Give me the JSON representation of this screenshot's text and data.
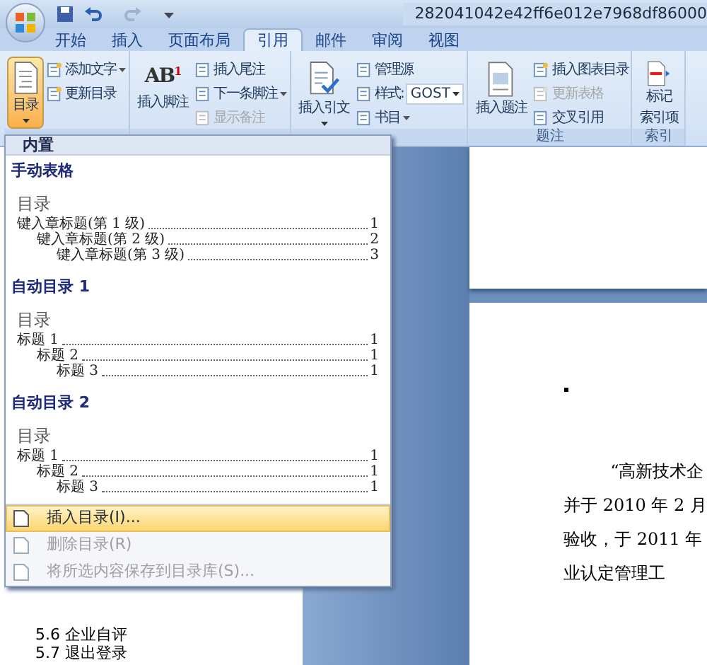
{
  "title_bar": {
    "title": "282041042e42ff6e012e7968df86000"
  },
  "tabs": [
    {
      "label": "开始",
      "selected": false
    },
    {
      "label": "插入",
      "selected": false
    },
    {
      "label": "页面布局",
      "selected": false
    },
    {
      "label": "引用",
      "selected": true
    },
    {
      "label": "邮件",
      "selected": false
    },
    {
      "label": "审阅",
      "selected": false
    },
    {
      "label": "视图",
      "selected": false
    }
  ],
  "ribbon": {
    "groups": [
      {
        "big": {
          "lines": [
            "目录"
          ],
          "caret": true,
          "pressed": true
        },
        "small": [
          {
            "kind": "button",
            "label": "添加文字",
            "caret": true,
            "disabled": false
          },
          {
            "kind": "button",
            "label": "更新目录",
            "caret": false,
            "disabled": false
          }
        ]
      },
      {
        "big": {
          "lines": [
            "插入脚注"
          ],
          "caret": false,
          "pressed": false,
          "glyph": "AB",
          "glyph_sup": "1"
        },
        "small": [
          {
            "kind": "button",
            "label": "插入尾注",
            "caret": false,
            "disabled": false
          },
          {
            "kind": "button",
            "label": "下一条脚注",
            "caret": true,
            "disabled": false
          },
          {
            "kind": "button",
            "label": "显示备注",
            "caret": false,
            "disabled": true
          }
        ]
      },
      {
        "big": {
          "lines": [
            "插入引文"
          ],
          "caret": true,
          "pressed": false
        },
        "small": [
          {
            "kind": "button",
            "label": "管理源",
            "caret": false,
            "disabled": false
          },
          {
            "kind": "select",
            "label": "样式:",
            "value": "GOST"
          },
          {
            "kind": "button",
            "label": "书目",
            "caret": true,
            "disabled": false
          }
        ]
      },
      {
        "label": "题注",
        "big": {
          "lines": [
            "插入题注"
          ],
          "caret": false,
          "pressed": false
        },
        "small": [
          {
            "kind": "button",
            "label": "插入图表目录",
            "caret": false,
            "disabled": false
          },
          {
            "kind": "button",
            "label": "更新表格",
            "caret": false,
            "disabled": true
          },
          {
            "kind": "button",
            "label": "交叉引用",
            "caret": false,
            "disabled": false
          }
        ]
      },
      {
        "label": "索引",
        "big": {
          "lines": [
            "标记",
            "索引项"
          ],
          "caret": false,
          "pressed": false
        }
      }
    ]
  },
  "toc_menu": {
    "header": "内置",
    "sections": [
      {
        "title": "手动表格",
        "preview_title": "目录",
        "entries": [
          {
            "text": "键入章标题(第 1 级)",
            "page": "1",
            "children": [
              {
                "text": "键入章标题(第 2 级)",
                "page": "2",
                "children": [
                  {
                    "text": "键入章标题(第 3 级)",
                    "page": "3"
                  }
                ]
              }
            ]
          }
        ]
      },
      {
        "title": "自动目录 1",
        "preview_title": "目录",
        "entries": [
          {
            "text": "标题 1",
            "page": "1",
            "children": [
              {
                "text": "标题 2",
                "page": "1",
                "children": [
                  {
                    "text": "标题 3",
                    "page": "1"
                  }
                ]
              }
            ]
          }
        ]
      },
      {
        "title": "自动目录 2",
        "preview_title": "目录",
        "entries": [
          {
            "text": "标题 1",
            "page": "1",
            "children": [
              {
                "text": "标题 2",
                "page": "1",
                "children": [
                  {
                    "text": "标题 3",
                    "page": "1"
                  }
                ]
              }
            ]
          }
        ]
      }
    ],
    "items": [
      {
        "label": "插入目录(I)...",
        "selected": true,
        "disabled": false
      },
      {
        "label": "删除目录(R)",
        "selected": false,
        "disabled": true
      },
      {
        "label": "将所选内容保存到目录库(S)...",
        "selected": false,
        "disabled": true
      }
    ]
  },
  "outline": [
    "5.6 企业自评",
    "5.7 退出登录"
  ],
  "document": {
    "paragraph_lines": [
      "“高新技术企",
      "并于 2010 年 2 月",
      "验收，于 2011 年",
      "业认定管理工"
    ]
  }
}
